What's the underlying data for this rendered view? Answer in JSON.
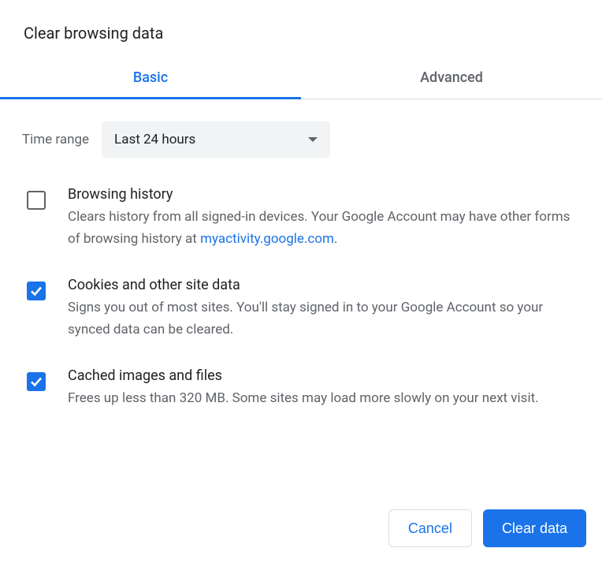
{
  "dialog": {
    "title": "Clear browsing data"
  },
  "tabs": {
    "basic": "Basic",
    "advanced": "Advanced"
  },
  "time_range": {
    "label": "Time range",
    "value": "Last 24 hours"
  },
  "options": {
    "browsing_history": {
      "checked": false,
      "title": "Browsing history",
      "desc_before_link": "Clears history from all signed-in devices. Your Google Account may have other forms of browsing history at ",
      "link_text": "myactivity.google.com",
      "desc_after_link": "."
    },
    "cookies": {
      "checked": true,
      "title": "Cookies and other site data",
      "desc": "Signs you out of most sites. You'll stay signed in to your Google Account so your synced data can be cleared."
    },
    "cache": {
      "checked": true,
      "title": "Cached images and files",
      "desc": "Frees up less than 320 MB. Some sites may load more slowly on your next visit."
    }
  },
  "footer": {
    "cancel": "Cancel",
    "clear": "Clear data"
  }
}
